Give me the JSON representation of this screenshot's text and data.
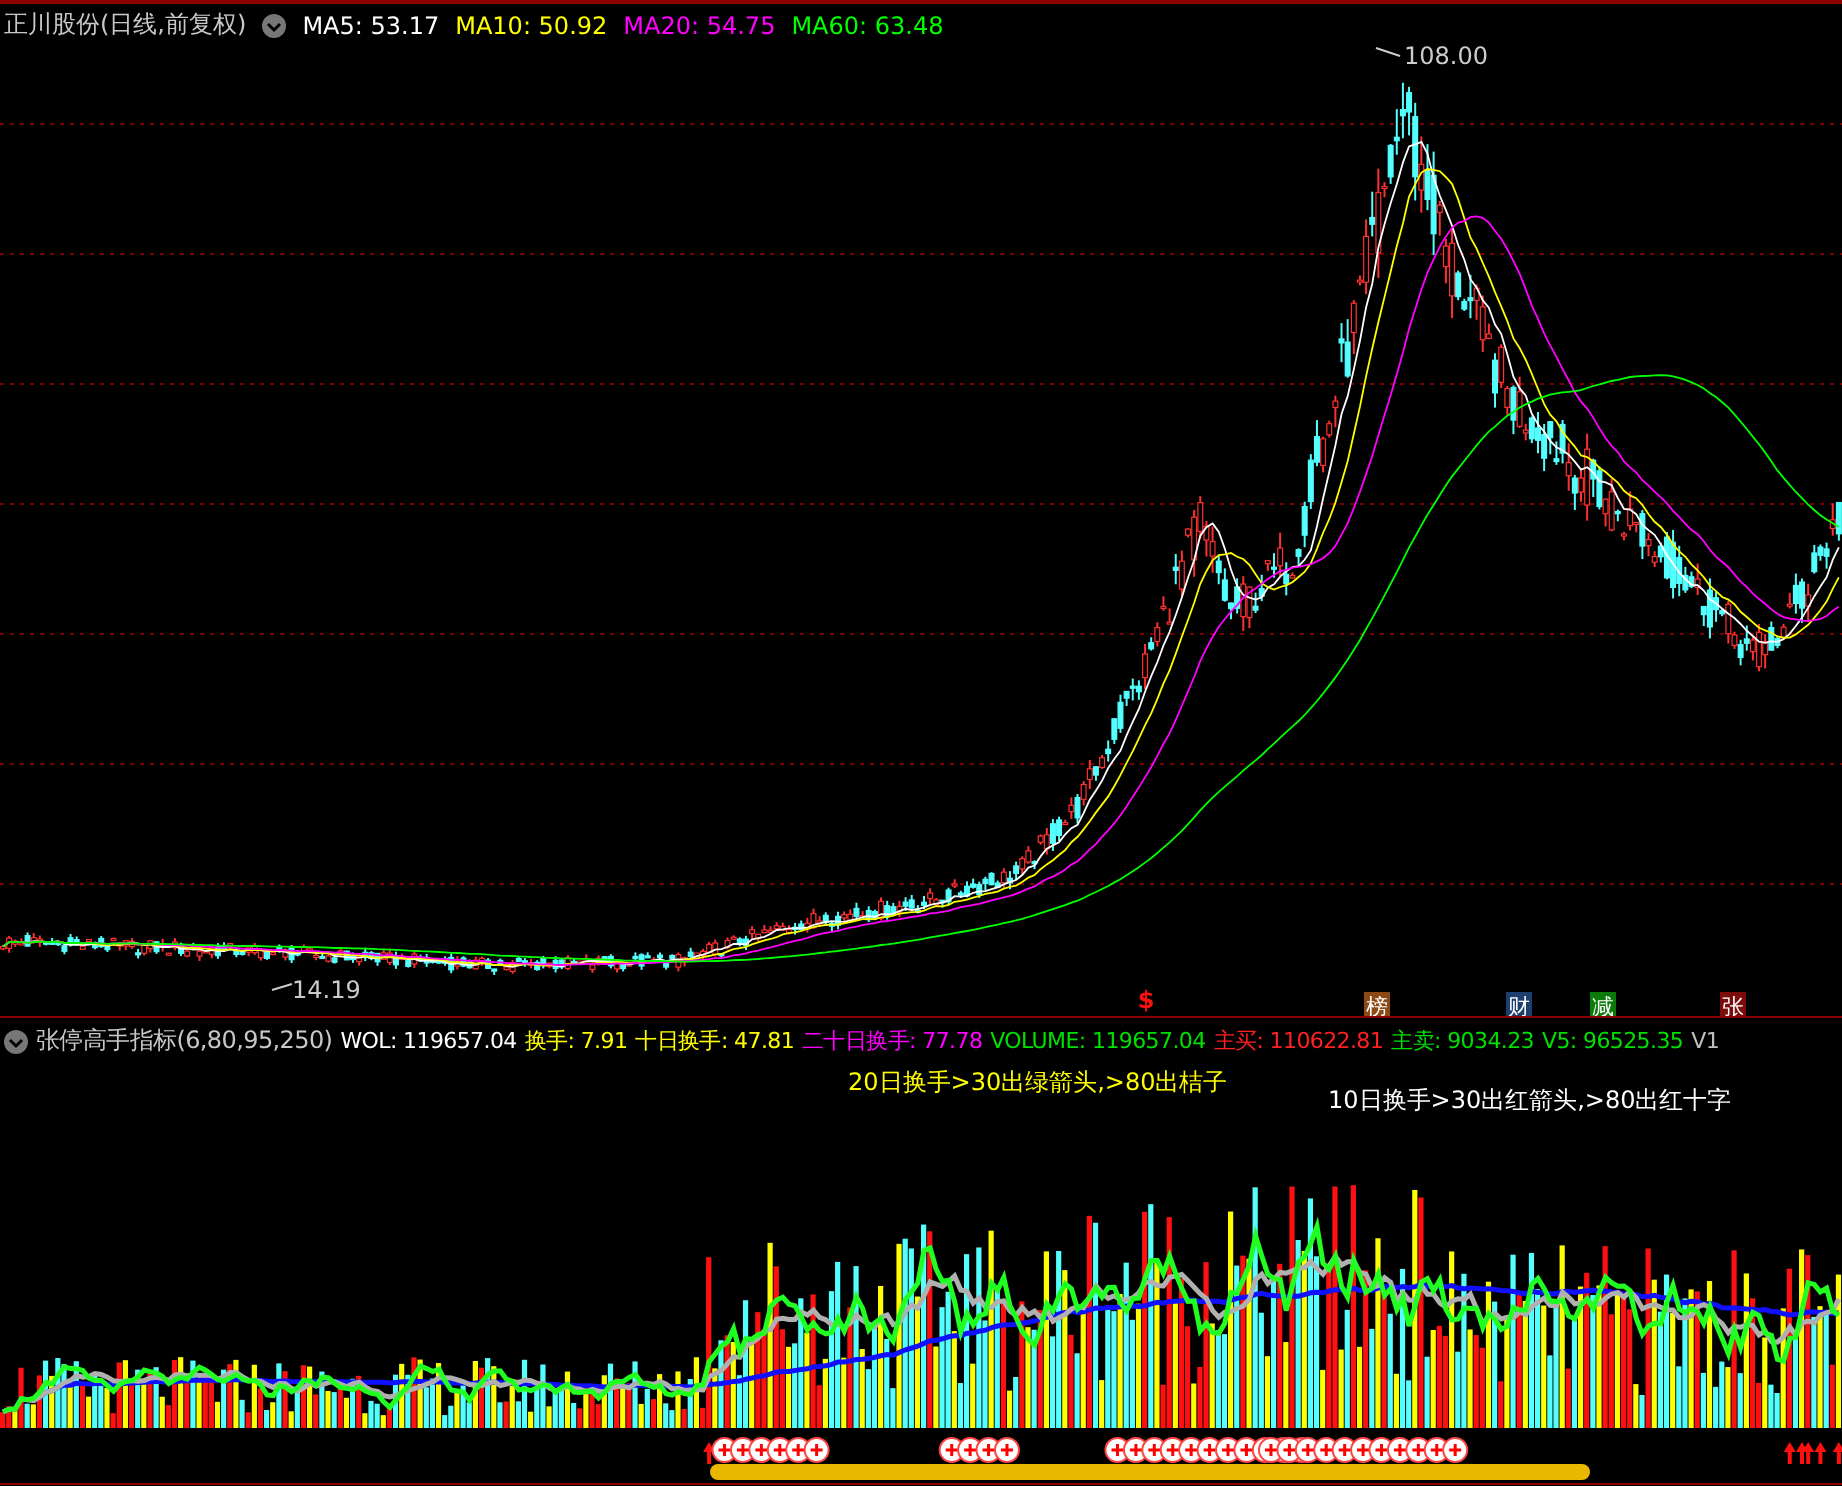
{
  "main": {
    "title": "正川股份(日线,前复权)",
    "ma": [
      {
        "label": "MA5: 53.17",
        "color": "#ffffff"
      },
      {
        "label": "MA10: 50.92",
        "color": "#ffff00"
      },
      {
        "label": "MA20: 54.75",
        "color": "#ff00ff"
      },
      {
        "label": "MA60: 63.48",
        "color": "#00ff00"
      }
    ],
    "high_label": "108.00",
    "low_label": "14.19",
    "markers": [
      {
        "text": "$",
        "color": "#ff1010",
        "kind": "symbol"
      },
      {
        "text": "榜",
        "color": "#8b4a14",
        "kind": "tag"
      },
      {
        "text": "财",
        "color": "#1c3f6e",
        "kind": "tag"
      },
      {
        "text": "减",
        "color": "#0a7a0a",
        "kind": "tag"
      },
      {
        "text": "张",
        "color": "#7a0c0c",
        "kind": "tag"
      }
    ]
  },
  "indicator": {
    "title": "张停高手指标(6,80,95,250)",
    "values": [
      {
        "label": "WOL: 119657.04",
        "color": "#ffffff"
      },
      {
        "label": "换手: 7.91",
        "color": "#ffff00"
      },
      {
        "label": "十日换手: 47.81",
        "color": "#ffff00"
      },
      {
        "label": "二十日换手: 77.78",
        "color": "#ff00ff"
      },
      {
        "label": "VOLUME: 119657.04",
        "color": "#00e000"
      },
      {
        "label": "主买: 110622.81",
        "color": "#ff2020"
      },
      {
        "label": "主卖: 9034.23",
        "color": "#00e000"
      },
      {
        "label": "V5: 96525.35",
        "color": "#00e000"
      },
      {
        "label": "V1",
        "color": "#c0c0c0"
      }
    ],
    "notes": [
      {
        "text": "20日换手>30出绿箭头,>80出桔子",
        "color": "#ffff00"
      },
      {
        "text": "10日换手>30出红箭头,>80出红十字",
        "color": "#ffffff"
      }
    ]
  }
}
